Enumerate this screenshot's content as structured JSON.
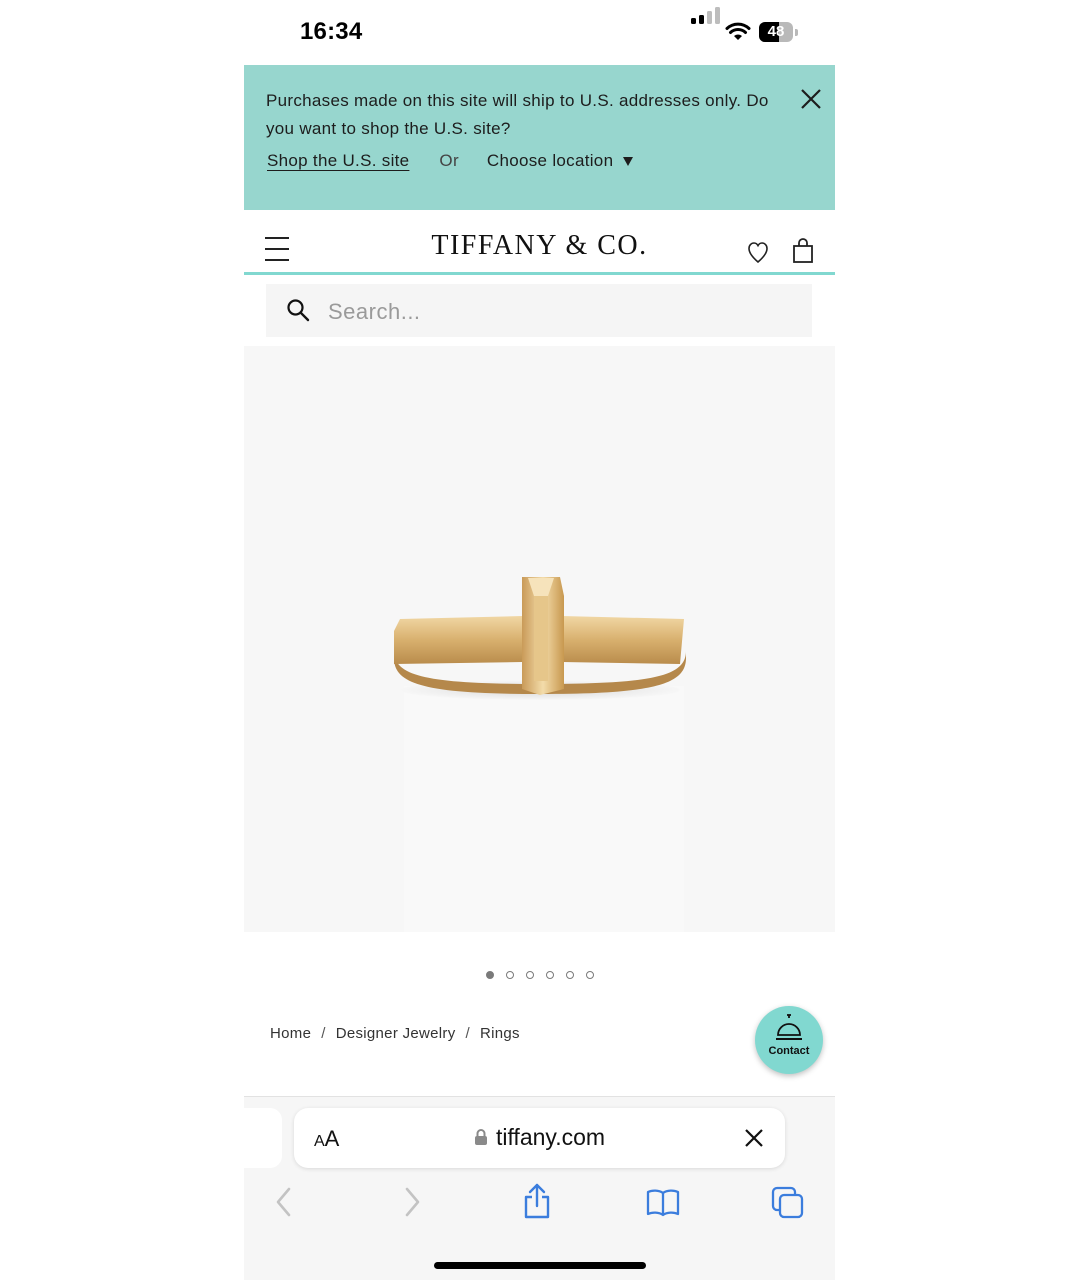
{
  "status_bar": {
    "time": "16:34",
    "battery": "48"
  },
  "banner": {
    "message": "Purchases made on this site will ship to U.S. addresses only. Do you want to shop the U.S. site?",
    "shop_link": "Shop the U.S. site",
    "or": "Or",
    "choose_location": "Choose location"
  },
  "header": {
    "logo": "TIFFANY & CO."
  },
  "search": {
    "placeholder": "Search..."
  },
  "carousel": {
    "total_images": 6,
    "active_index": 0
  },
  "breadcrumb": {
    "items": [
      "Home",
      "Designer Jewelry",
      "Rings"
    ]
  },
  "contact": {
    "label": "Contact"
  },
  "browser": {
    "text_size": "AA",
    "url": "tiffany.com"
  },
  "colors": {
    "brand_tiffany_blue": "#81d8d0",
    "banner_bg": "#97d6ce",
    "safari_blue": "#3b7ddd"
  }
}
